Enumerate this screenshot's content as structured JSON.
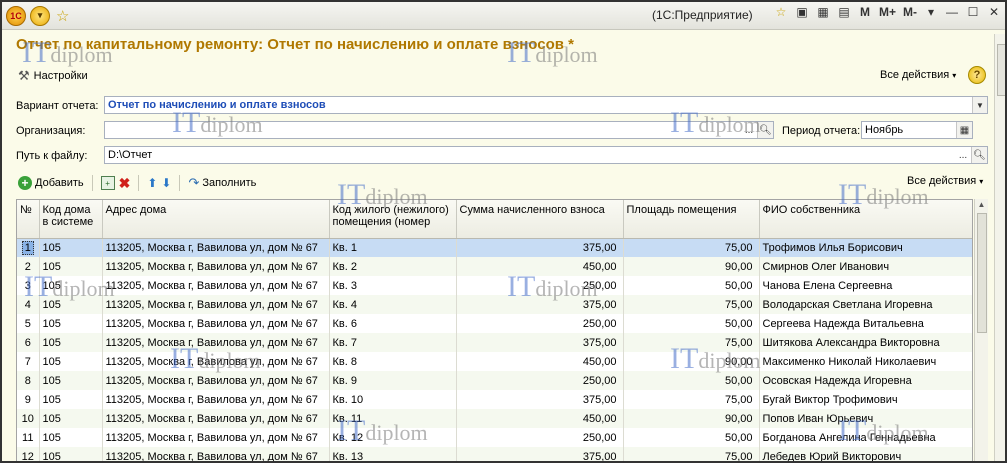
{
  "app": {
    "window_title": "(1С:Предприятие)",
    "title_tools": [
      "M",
      "M+",
      "M-"
    ]
  },
  "form": {
    "title": "Отчет по капитальному ремонту: Отчет по начислению и оплате взносов *",
    "settings_label": "Настройки",
    "all_actions_label": "Все действия",
    "help_label": "?"
  },
  "filters": {
    "variant_label": "Вариант отчета:",
    "variant_value": "Отчет по начислению и оплате взносов",
    "org_label": "Организация:",
    "org_value": "",
    "period_label": "Период отчета:",
    "period_value": "Ноябрь",
    "path_label": "Путь к файлу:",
    "path_value": "D:\\Отчет",
    "ellipsis": "..."
  },
  "toolbar": {
    "add_label": "Добавить",
    "fill_label": "Заполнить",
    "all_actions_label": "Все действия"
  },
  "table": {
    "headers": [
      "№",
      "Код дома в системе",
      "Адрес дома",
      "Код жилого (нежилого) помещения (номер",
      "Сумма начисленного взноса",
      "Площадь помещения",
      "ФИО собственника"
    ],
    "rows": [
      [
        "1",
        "105",
        "113205, Москва г, Вавилова ул, дом № 67",
        "Кв. 1",
        "375,00",
        "75,00",
        "Трофимов Илья Борисович"
      ],
      [
        "2",
        "105",
        "113205, Москва г, Вавилова ул, дом № 67",
        "Кв. 2",
        "450,00",
        "90,00",
        "Смирнов Олег Иванович"
      ],
      [
        "3",
        "105",
        "113205, Москва г, Вавилова ул, дом № 67",
        "Кв. 3",
        "250,00",
        "50,00",
        "Чанова Елена Сергеевна"
      ],
      [
        "4",
        "105",
        "113205, Москва г, Вавилова ул, дом № 67",
        "Кв. 4",
        "375,00",
        "75,00",
        "Володарская Светлана Игоревна"
      ],
      [
        "5",
        "105",
        "113205, Москва г, Вавилова ул, дом № 67",
        "Кв. 6",
        "250,00",
        "50,00",
        "Сергеева Надежда Витальевна"
      ],
      [
        "6",
        "105",
        "113205, Москва г, Вавилова ул, дом № 67",
        "Кв. 7",
        "375,00",
        "75,00",
        "Шитякова Александра Викторовна"
      ],
      [
        "7",
        "105",
        "113205, Москва г, Вавилова ул, дом № 67",
        "Кв. 8",
        "450,00",
        "90,00",
        "Максименко Николай Николаевич"
      ],
      [
        "8",
        "105",
        "113205, Москва г, Вавилова ул, дом № 67",
        "Кв. 9",
        "250,00",
        "50,00",
        "Осовская Надежда Игоревна"
      ],
      [
        "9",
        "105",
        "113205, Москва г, Вавилова ул, дом № 67",
        "Кв. 10",
        "375,00",
        "75,00",
        "Бугай Виктор Трофимович"
      ],
      [
        "10",
        "105",
        "113205, Москва г, Вавилова ул, дом № 67",
        "Кв. 11",
        "450,00",
        "90,00",
        "Попов Иван Юрьевич"
      ],
      [
        "11",
        "105",
        "113205, Москва г, Вавилова ул, дом № 67",
        "Кв. 12",
        "250,00",
        "50,00",
        "Богданова Ангелина Геннадьевна"
      ],
      [
        "12",
        "105",
        "113205, Москва г, Вавилова ул, дом № 67",
        "Кв. 13",
        "375,00",
        "75,00",
        "Лебедев Юрий Викторович"
      ]
    ],
    "selected_row": 0
  },
  "watermark": {
    "a": "IT",
    "b": "diplom"
  }
}
